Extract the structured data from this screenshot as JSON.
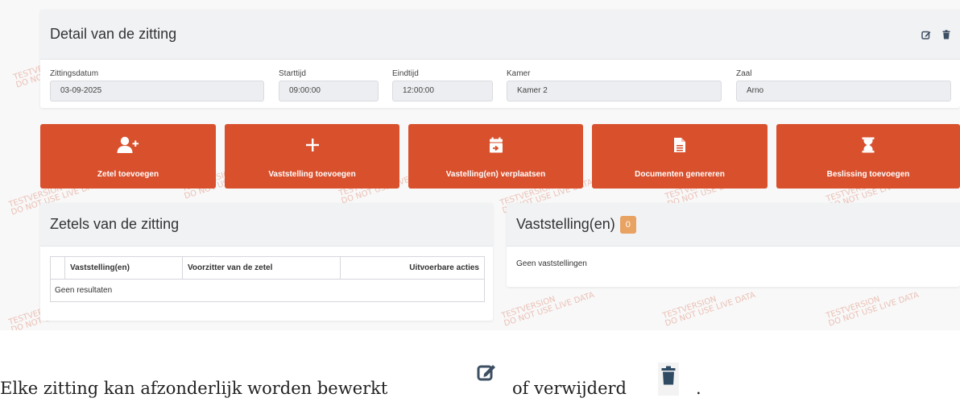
{
  "watermark": {
    "line1": "TESTVERSION",
    "line2": "DO NOT USE LIVE DATA"
  },
  "session_detail": {
    "title": "Detail van de zitting",
    "icons": [
      "edit-icon",
      "trash-icon"
    ],
    "fields": {
      "date": {
        "label": "Zittingsdatum",
        "value": "03-09-2025"
      },
      "start": {
        "label": "Starttijd",
        "value": "09:00:00"
      },
      "end": {
        "label": "Eindtijd",
        "value": "12:00:00"
      },
      "room": {
        "label": "Kamer",
        "value": "Kamer 2"
      },
      "hall": {
        "label": "Zaal",
        "value": "Arno"
      }
    }
  },
  "actions": [
    {
      "label": "Zetel toevoegen",
      "icon": "user-plus-icon"
    },
    {
      "label": "Vaststelling toevoegen",
      "icon": "plus-icon"
    },
    {
      "label": "Vastelling(en) verplaatsen",
      "icon": "calendar-move-icon"
    },
    {
      "label": "Documenten genereren",
      "icon": "document-icon"
    },
    {
      "label": "Beslissing toevoegen",
      "icon": "hourglass-icon"
    }
  ],
  "seats": {
    "title": "Zetels van de zitting",
    "columns": [
      "",
      "Vaststelling(en)",
      "Voorzitter van de zetel",
      "Uitvoerbare acties"
    ],
    "empty": "Geen resultaten"
  },
  "findings": {
    "title": "Vaststelling(en)",
    "count": "0",
    "empty": "Geen vaststellingen"
  },
  "caption": {
    "part1": "Elke zitting kan afzonderlijk worden bewerkt",
    "part2": "of verwijderd",
    "part3": "."
  },
  "colors": {
    "accent": "#d9502d",
    "badge": "#e8a262",
    "icon": "#3d4f63"
  }
}
